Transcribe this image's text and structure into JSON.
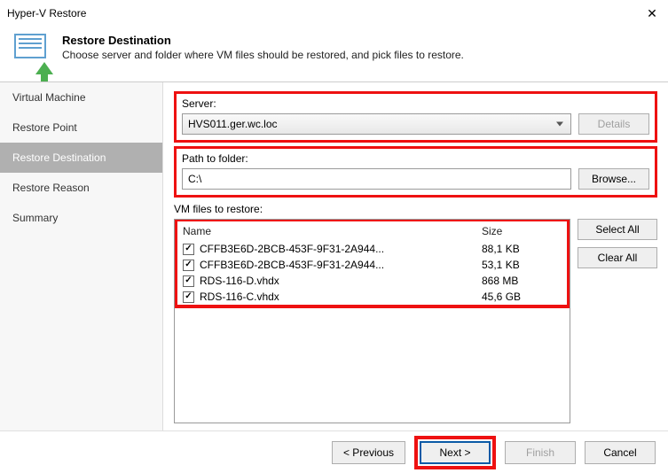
{
  "titlebar": {
    "title": "Hyper-V Restore",
    "close": "✕"
  },
  "header": {
    "title": "Restore Destination",
    "subtitle": "Choose server and folder where VM files should be restored, and pick files to restore."
  },
  "sidebar": {
    "items": [
      {
        "label": "Virtual Machine"
      },
      {
        "label": "Restore Point"
      },
      {
        "label": "Restore Destination"
      },
      {
        "label": "Restore Reason"
      },
      {
        "label": "Summary"
      }
    ]
  },
  "form": {
    "server_label": "Server:",
    "server_value": "HVS011.ger.wc.loc",
    "details_btn": "Details",
    "path_label": "Path to folder:",
    "path_value": "C:\\",
    "browse_btn": "Browse...",
    "files_label": "VM files to restore:",
    "col_name": "Name",
    "col_size": "Size",
    "select_all": "Select All",
    "clear_all": "Clear All",
    "files": [
      {
        "name": "CFFB3E6D-2BCB-453F-9F31-2A944...",
        "size": "88,1 KB",
        "checked": true
      },
      {
        "name": "CFFB3E6D-2BCB-453F-9F31-2A944...",
        "size": "53,1 KB",
        "checked": true
      },
      {
        "name": "RDS-116-D.vhdx",
        "size": "868 MB",
        "checked": true
      },
      {
        "name": "RDS-116-C.vhdx",
        "size": "45,6 GB",
        "checked": true
      }
    ]
  },
  "footer": {
    "previous": "< Previous",
    "next": "Next >",
    "finish": "Finish",
    "cancel": "Cancel"
  }
}
